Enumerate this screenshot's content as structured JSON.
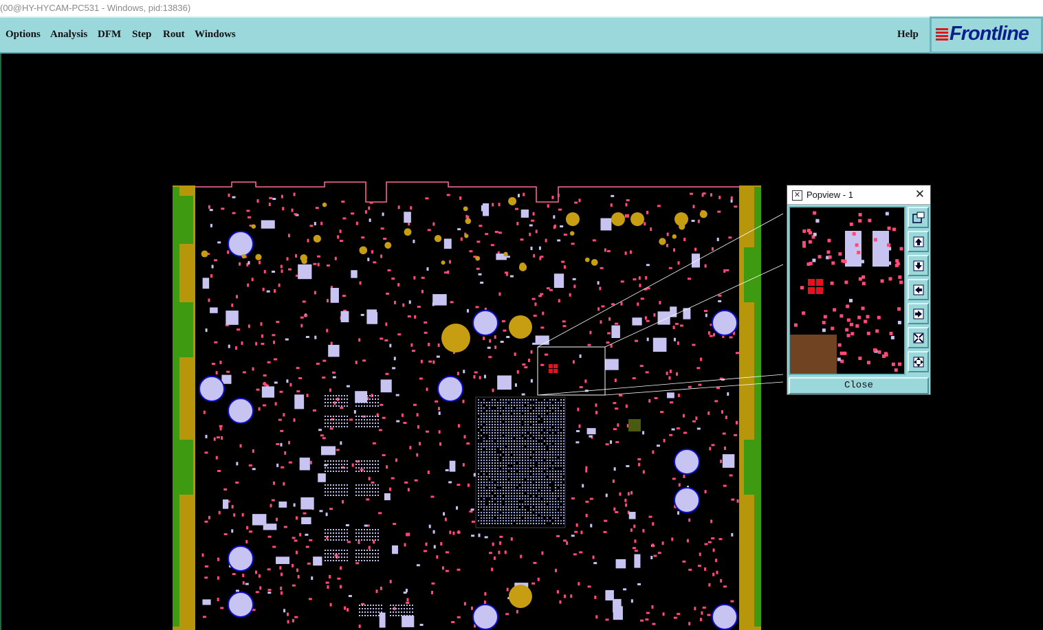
{
  "window": {
    "title": "(00@HY-HYCAM-PC531 - Windows, pid:13836)"
  },
  "menu": {
    "options": "Options",
    "analysis": "Analysis",
    "dfm": "DFM",
    "step": "Step",
    "rout": "Rout",
    "windows": "Windows",
    "help": "Help"
  },
  "logo": {
    "text": "Frontline"
  },
  "popview": {
    "title": "Popview - 1",
    "close_label": "Close",
    "buttons": [
      "zoom-window-icon",
      "pan-up-icon",
      "pan-down-icon",
      "pan-left-icon",
      "pan-right-icon",
      "zoom-fit-icon",
      "move-icon"
    ]
  },
  "colors": {
    "menu_bg": "#9bd8dc",
    "board_gold": "#b8960c",
    "board_green": "#3e9a10",
    "pad_pink": "#ff4a7a",
    "pad_lavender": "#c8c4f2",
    "pad_red": "#e8101a",
    "via_gold": "#c79d12"
  }
}
